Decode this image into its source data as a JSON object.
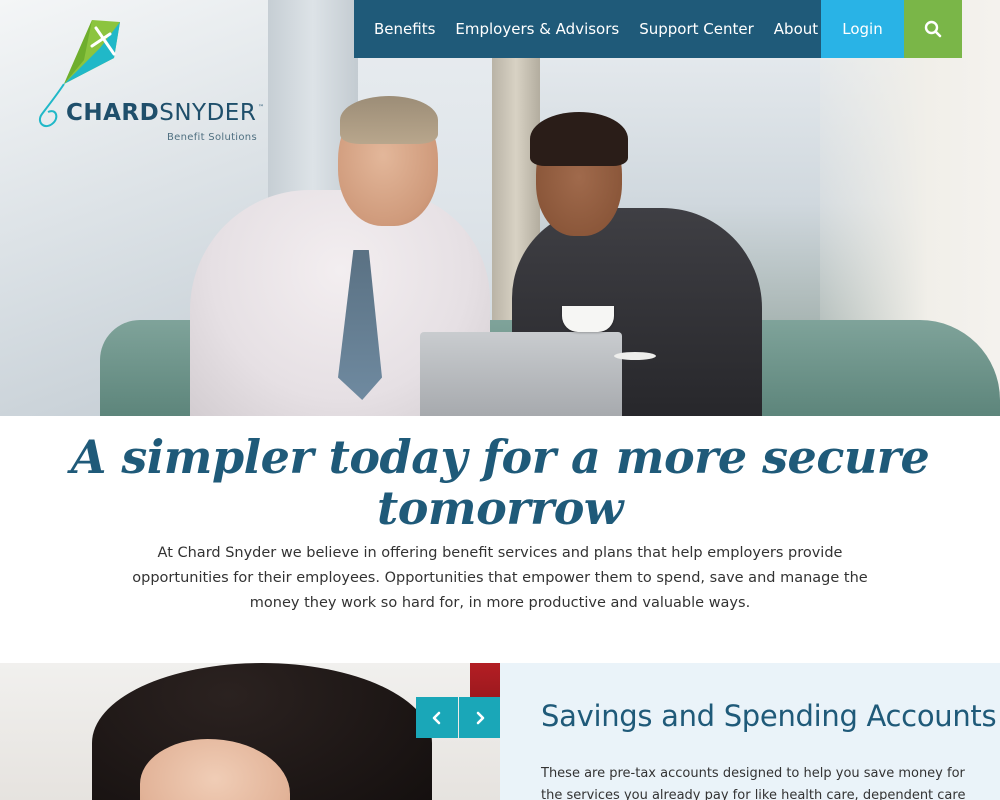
{
  "brand": {
    "name_part1": "CHARD",
    "name_part2": "SNYDER",
    "trademark": "™",
    "tagline": "Benefit Solutions",
    "colors": {
      "navy": "#1f5a79",
      "sky": "#29b3e6",
      "green": "#7ab648",
      "teal": "#1aa7b8"
    }
  },
  "nav": {
    "items": [
      {
        "label": "Benefits"
      },
      {
        "label": "Employers & Advisors"
      },
      {
        "label": "Support Center"
      },
      {
        "label": "About"
      }
    ],
    "login_label": "Login",
    "search_icon": "search-icon"
  },
  "hero": {
    "headline": "A simpler today for a more secure tomorrow",
    "intro": "At Chard Snyder we believe in offering benefit services and plans that help employers provide opportunities for their employees. Opportunities that empower them to spend, save and manage the money they work so hard for, in more productive and valuable ways."
  },
  "feature": {
    "title": "Savings and Spending Accounts",
    "text": "These are pre-tax accounts designed to help you save money for the services you already pay for like health care, dependent care and",
    "prev_icon": "chevron-left-icon",
    "next_icon": "chevron-right-icon"
  }
}
